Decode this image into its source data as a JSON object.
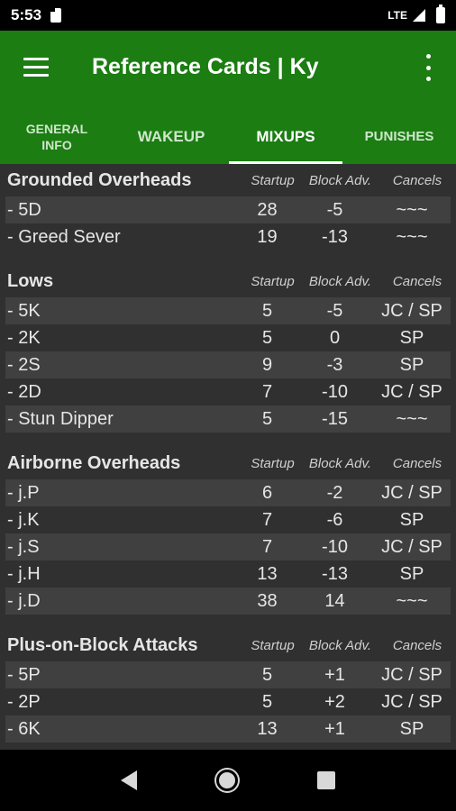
{
  "status_bar": {
    "time": "5:53",
    "network": "LTE"
  },
  "app_bar": {
    "title": "Reference Cards | Ky"
  },
  "tabs": [
    {
      "label": "GENERAL\nINFO",
      "active": false
    },
    {
      "label": "WAKEUP",
      "active": false
    },
    {
      "label": "MIXUPS",
      "active": true
    },
    {
      "label": "PUNISHES",
      "active": false
    }
  ],
  "columns": {
    "startup": "Startup",
    "block_adv": "Block Adv.",
    "cancels": "Cancels"
  },
  "sections": [
    {
      "title": "Grounded Overheads",
      "rows": [
        {
          "move": "- 5D",
          "startup": "28",
          "block_adv": "-5",
          "cancels": "~~~"
        },
        {
          "move": "- Greed Sever",
          "startup": "19",
          "block_adv": "-13",
          "cancels": "~~~"
        }
      ]
    },
    {
      "title": "Lows",
      "rows": [
        {
          "move": "- 5K",
          "startup": "5",
          "block_adv": "-5",
          "cancels": "JC / SP"
        },
        {
          "move": "- 2K",
          "startup": "5",
          "block_adv": "0",
          "cancels": "SP"
        },
        {
          "move": "- 2S",
          "startup": "9",
          "block_adv": "-3",
          "cancels": "SP"
        },
        {
          "move": "- 2D",
          "startup": "7",
          "block_adv": "-10",
          "cancels": "JC / SP"
        },
        {
          "move": "- Stun Dipper",
          "startup": "5",
          "block_adv": "-15",
          "cancels": "~~~"
        }
      ]
    },
    {
      "title": "Airborne Overheads",
      "rows": [
        {
          "move": "- j.P",
          "startup": "6",
          "block_adv": "-2",
          "cancels": "JC / SP"
        },
        {
          "move": "- j.K",
          "startup": "7",
          "block_adv": "-6",
          "cancels": "SP"
        },
        {
          "move": "- j.S",
          "startup": "7",
          "block_adv": "-10",
          "cancels": "JC / SP"
        },
        {
          "move": "- j.H",
          "startup": "13",
          "block_adv": "-13",
          "cancels": "SP"
        },
        {
          "move": "- j.D",
          "startup": "38",
          "block_adv": "14",
          "cancels": "~~~"
        }
      ]
    },
    {
      "title": "Plus-on-Block Attacks",
      "rows": [
        {
          "move": "- 5P",
          "startup": "5",
          "block_adv": "+1",
          "cancels": "JC / SP"
        },
        {
          "move": "- 2P",
          "startup": "5",
          "block_adv": "+2",
          "cancels": "JC / SP"
        },
        {
          "move": "- 6K",
          "startup": "13",
          "block_adv": "+1",
          "cancels": "SP"
        }
      ]
    }
  ],
  "colors": {
    "app_bar": "#1b7d12",
    "background": "#303030",
    "row_stripe": "#404040"
  }
}
